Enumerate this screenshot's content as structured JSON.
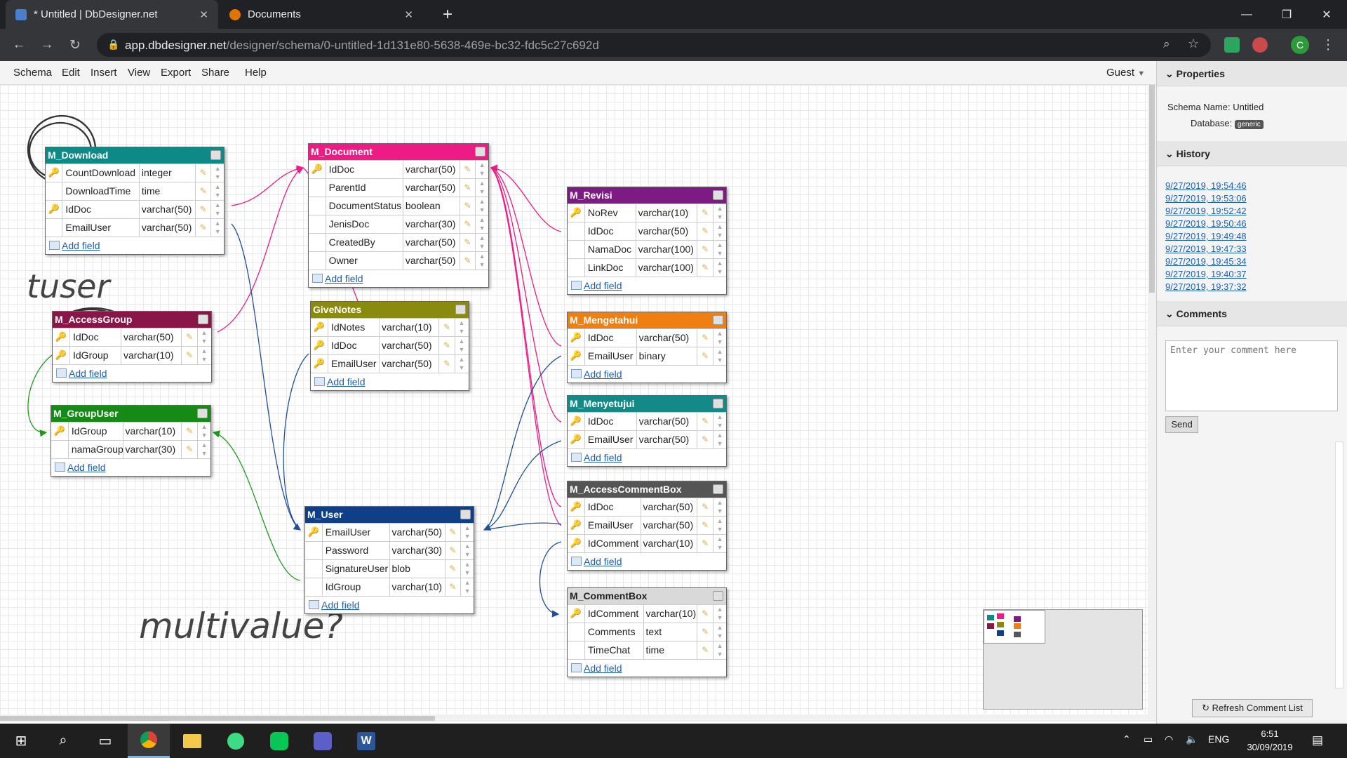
{
  "browser": {
    "tabs": [
      {
        "title": "* Untitled | DbDesigner.net",
        "active": true
      },
      {
        "title": "Documents",
        "active": false
      }
    ],
    "new_tab": "+",
    "url_host": "app.dbdesigner.net",
    "url_path": "/designer/schema/0-untitled-1d131e80-5638-469e-bc32-fdc5c27c692d",
    "profile_initial": "C"
  },
  "menu": {
    "items": [
      "Schema",
      "Edit",
      "Insert",
      "View",
      "Export",
      "Share",
      "Help"
    ],
    "user": "Guest"
  },
  "add_field_label": "Add field",
  "tables": {
    "M_Download": {
      "name": "M_Download",
      "color": "#0e8a86",
      "fields": [
        {
          "name": "CountDownload",
          "type": "integer",
          "key": true
        },
        {
          "name": "DownloadTime",
          "type": "time",
          "key": false
        },
        {
          "name": "IdDoc",
          "type": "varchar(50)",
          "key": true
        },
        {
          "name": "EmailUser",
          "type": "varchar(50)",
          "key": false
        }
      ]
    },
    "M_Document": {
      "name": "M_Document",
      "color": "#ee1a86",
      "fields": [
        {
          "name": "IdDoc",
          "type": "varchar(50)",
          "key": true
        },
        {
          "name": "ParentId",
          "type": "varchar(50)",
          "key": false
        },
        {
          "name": "DocumentStatus",
          "type": "boolean",
          "key": false
        },
        {
          "name": "JenisDoc",
          "type": "varchar(30)",
          "key": false
        },
        {
          "name": "CreatedBy",
          "type": "varchar(50)",
          "key": false
        },
        {
          "name": "Owner",
          "type": "varchar(50)",
          "key": false
        }
      ]
    },
    "M_Revisi": {
      "name": "M_Revisi",
      "color": "#7e1a84",
      "fields": [
        {
          "name": "NoRev",
          "type": "varchar(10)",
          "key": true
        },
        {
          "name": "IdDoc",
          "type": "varchar(50)",
          "key": false
        },
        {
          "name": "NamaDoc",
          "type": "varchar(100)",
          "key": false
        },
        {
          "name": "LinkDoc",
          "type": "varchar(100)",
          "key": false
        }
      ]
    },
    "M_AccessGroup": {
      "name": "M_AccessGroup",
      "color": "#8a1648",
      "fields": [
        {
          "name": "IdDoc",
          "type": "varchar(50)",
          "key": true
        },
        {
          "name": "IdGroup",
          "type": "varchar(10)",
          "key": true
        }
      ]
    },
    "GiveNotes": {
      "name": "GiveNotes",
      "color": "#8a8a10",
      "fields": [
        {
          "name": "IdNotes",
          "type": "varchar(10)",
          "key": true
        },
        {
          "name": "IdDoc",
          "type": "varchar(50)",
          "key": true
        },
        {
          "name": "EmailUser",
          "type": "varchar(50)",
          "key": true
        }
      ]
    },
    "M_Mengetahui": {
      "name": "M_Mengetahui",
      "color": "#f07f12",
      "fields": [
        {
          "name": "IdDoc",
          "type": "varchar(50)",
          "key": true
        },
        {
          "name": "EmailUser",
          "type": "binary",
          "key": true
        }
      ]
    },
    "M_GroupUser": {
      "name": "M_GroupUser",
      "color": "#168a16",
      "fields": [
        {
          "name": "IdGroup",
          "type": "varchar(10)",
          "key": true
        },
        {
          "name": "namaGroup",
          "type": "varchar(30)",
          "key": false
        }
      ]
    },
    "M_Menyetujui": {
      "name": "M_Menyetujui",
      "color": "#148a88",
      "fields": [
        {
          "name": "IdDoc",
          "type": "varchar(50)",
          "key": true
        },
        {
          "name": "EmailUser",
          "type": "varchar(50)",
          "key": true
        }
      ]
    },
    "M_AccessCommentBox": {
      "name": "M_AccessCommentBox",
      "color": "#555555",
      "fields": [
        {
          "name": "IdDoc",
          "type": "varchar(50)",
          "key": true
        },
        {
          "name": "EmailUser",
          "type": "varchar(50)",
          "key": true
        },
        {
          "name": "IdComment",
          "type": "varchar(10)",
          "key": true
        }
      ]
    },
    "M_User": {
      "name": "M_User",
      "color": "#0f3f86",
      "fields": [
        {
          "name": "EmailUser",
          "type": "varchar(50)",
          "key": true
        },
        {
          "name": "Password",
          "type": "varchar(30)",
          "key": false
        },
        {
          "name": "SignatureUser",
          "type": "blob",
          "key": false
        },
        {
          "name": "IdGroup",
          "type": "varchar(10)",
          "key": false
        }
      ]
    },
    "M_CommentBox": {
      "name": "M_CommentBox",
      "color": "#d9d9d9",
      "fields": [
        {
          "name": "IdComment",
          "type": "varchar(10)",
          "key": true
        },
        {
          "name": "Comments",
          "type": "text",
          "key": false
        },
        {
          "name": "TimeChat",
          "type": "time",
          "key": false
        }
      ]
    }
  },
  "annotations": {
    "tuser": "tuser",
    "multivalue": "multivalue?"
  },
  "panel": {
    "properties_title": "Properties",
    "schema_name_label": "Schema Name:",
    "schema_name": "Untitled",
    "database_label": "Database:",
    "database": "generic",
    "history_title": "History",
    "history": [
      "9/27/2019, 19:54:46",
      "9/27/2019, 19:53:06",
      "9/27/2019, 19:52:42",
      "9/27/2019, 19:50:46",
      "9/27/2019, 19:49:48",
      "9/27/2019, 19:47:33",
      "9/27/2019, 19:45:34",
      "9/27/2019, 19:40:37",
      "9/27/2019, 19:37:32"
    ],
    "comments_title": "Comments",
    "comment_placeholder": "Enter your comment here",
    "send": "Send",
    "refresh": "Refresh Comment List"
  },
  "taskbar": {
    "lang": "ENG",
    "time": "6:51",
    "date": "30/09/2019"
  }
}
